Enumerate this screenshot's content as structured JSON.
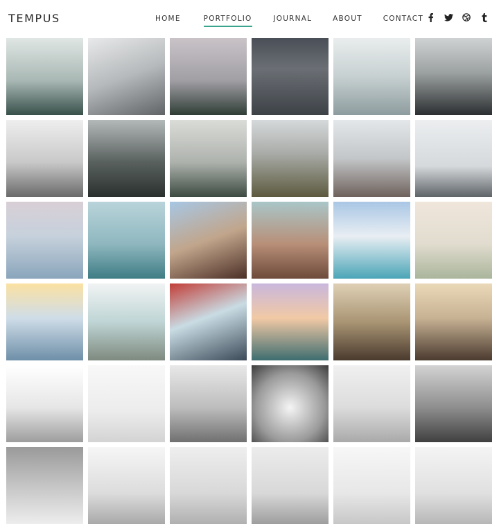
{
  "site": {
    "logo": "TEMPUS"
  },
  "nav": {
    "items": [
      {
        "label": "HOME",
        "active": false
      },
      {
        "label": "PORTFOLIO",
        "active": true
      },
      {
        "label": "JOURNAL",
        "active": false
      },
      {
        "label": "ABOUT",
        "active": false
      },
      {
        "label": "CONTACT",
        "active": false
      }
    ],
    "accent_color": "#3aa58c"
  },
  "social": [
    {
      "name": "facebook-icon",
      "glyph": "f"
    },
    {
      "name": "twitter-icon",
      "glyph": "t"
    },
    {
      "name": "dribbble-icon",
      "glyph": "d"
    },
    {
      "name": "tumblr-icon",
      "glyph": "t"
    }
  ],
  "portfolio": {
    "tiles": [
      {
        "name": "misty-pine-forest-photo",
        "bg": "linear-gradient(180deg,#dfe6e4 0%,#a9b8b4 55%,#38504b 100%)"
      },
      {
        "name": "snowy-mountain-valley-photo",
        "bg": "linear-gradient(160deg,#e7e9ea 0%,#b6b9bb 50%,#606467 100%)"
      },
      {
        "name": "foggy-treeline-photo",
        "bg": "linear-gradient(180deg,#c9c3c8 0%,#a19fa4 55%,#2f3d36 100%)"
      },
      {
        "name": "dark-mountain-road-photo",
        "bg": "linear-gradient(180deg,#4a4f57 0%,#6b6f75 40%,#3d4247 100%)"
      },
      {
        "name": "frosted-forest-photo",
        "bg": "linear-gradient(180deg,#e9eded 0%,#c7d0d1 50%,#8d9c9f 100%)"
      },
      {
        "name": "cloudy-dark-hills-photo",
        "bg": "linear-gradient(180deg,#cfd2d2 0%,#9ca1a1 45%,#2b2f31 100%)"
      },
      {
        "name": "mountain-in-clouds-photo",
        "bg": "linear-gradient(180deg,#eeeeee 0%,#c9c9c9 55%,#6a6a6a 100%)"
      },
      {
        "name": "foggy-dark-ridge-photo",
        "bg": "linear-gradient(180deg,#b3b9b9 0%,#59615f 55%,#2a302e 100%)"
      },
      {
        "name": "misty-pines-photo",
        "bg": "linear-gradient(180deg,#dadcd8 0%,#aeb2ad 55%,#3c4b42 100%)"
      },
      {
        "name": "tent-on-moor-photo",
        "bg": "linear-gradient(180deg,#d6d9db 0%,#a7aaa5 45%,#5d5a3f 100%)"
      },
      {
        "name": "birds-over-snowy-peak-photo",
        "bg": "linear-gradient(180deg,#e4e7e9 0%,#c3c6c8 50%,#6f625c 100%)"
      },
      {
        "name": "snowy-plain-photo",
        "bg": "linear-gradient(180deg,#eceef0 0%,#d5d9dc 60%,#5f6468 100%)"
      },
      {
        "name": "woman-at-sea-photo",
        "bg": "linear-gradient(180deg,#d9cfd6 0%,#c6d1dc 45%,#8aa5bb 100%)"
      },
      {
        "name": "swimmer-in-sea-photo",
        "bg": "linear-gradient(180deg,#b9d4da 0%,#8fb7bf 55%,#3e7c84 100%)"
      },
      {
        "name": "woman-reading-map-photo",
        "bg": "linear-gradient(160deg,#a7c7e4 0%,#c1a58b 50%,#4c2f26 100%)"
      },
      {
        "name": "woman-in-field-photo",
        "bg": "linear-gradient(180deg,#a9c6c8 0%,#b88f78 55%,#6d4a3a 100%)"
      },
      {
        "name": "airplane-wing-photo",
        "bg": "linear-gradient(180deg,#a9c6e5 0%,#e8eef3 45%,#4aa5b7 100%)"
      },
      {
        "name": "woman-by-shore-photo",
        "bg": "linear-gradient(180deg,#f0e6db 0%,#e1dccf 55%,#aab59b 100%)"
      },
      {
        "name": "sunset-beach-photo",
        "bg": "linear-gradient(180deg,#fbe1a2 0%,#cfdde8 45%,#6e8fa8 100%)"
      },
      {
        "name": "hiker-on-hill-photo",
        "bg": "linear-gradient(180deg,#f1f3f3 0%,#bfd5d5 50%,#7e8a7f 100%)"
      },
      {
        "name": "tent-view-photo",
        "bg": "linear-gradient(160deg,#c23e38 0%,#c9dce4 45%,#3b4a58 100%)"
      },
      {
        "name": "sunset-rock-photo",
        "bg": "linear-gradient(180deg,#c9b7dd 0%,#f1c9a5 45%,#3e6d70 100%)"
      },
      {
        "name": "friends-at-sunset-photo",
        "bg": "linear-gradient(180deg,#dfd0b5 0%,#a99574 50%,#4a3a2e 100%)"
      },
      {
        "name": "woman-with-scarf-photo",
        "bg": "linear-gradient(180deg,#ead9b8 0%,#c7b294 45%,#4b3a2f 100%)"
      },
      {
        "name": "lone-tree-photo",
        "bg": "linear-gradient(180deg,#ffffff 0%,#e6e6e6 55%,#9d9d9d 100%)"
      },
      {
        "name": "snow-tree-photo",
        "bg": "linear-gradient(180deg,#f8f8f8 0%,#ececec 60%,#d3d3d3 100%)"
      },
      {
        "name": "water-poles-photo",
        "bg": "linear-gradient(180deg,#e8e8e8 0%,#bdbdbd 55%,#707070 100%)"
      },
      {
        "name": "chairs-in-water-photo",
        "bg": "radial-gradient(circle at 50% 55%,#f5f5f5 0%,#9a9a9a 60%,#3b3b3b 100%)"
      },
      {
        "name": "foggy-lake-photo",
        "bg": "linear-gradient(180deg,#f0f0f0 0%,#dcdcdc 55%,#a9a9a9 100%)"
      },
      {
        "name": "pier-legs-photo",
        "bg": "linear-gradient(180deg,#d3d3d3 0%,#8e8e8e 55%,#404040 100%)"
      },
      {
        "name": "bridge-arch-photo",
        "bg": "linear-gradient(180deg,#9a9a9a 0%,#c9c9c9 55%,#ededed 100%)"
      },
      {
        "name": "misty-hills-bw-photo",
        "bg": "linear-gradient(180deg,#f6f6f6 0%,#dcdcdc 60%,#a9a9a9 100%)"
      },
      {
        "name": "fog-bank-photo",
        "bg": "linear-gradient(180deg,#eeeeee 0%,#d8d8d8 60%,#b0b0b0 100%)"
      },
      {
        "name": "reeds-photo",
        "bg": "linear-gradient(180deg,#ececec 0%,#d8d8d8 60%,#9e9e9e 100%)"
      },
      {
        "name": "grey-horizon-photo",
        "bg": "linear-gradient(180deg,#f7f7f7 0%,#e7e7e7 60%,#c7c7c7 100%)"
      },
      {
        "name": "fence-in-snow-photo",
        "bg": "linear-gradient(180deg,#f4f4f4 0%,#e0e0e0 60%,#b7b7b7 100%)"
      }
    ]
  }
}
